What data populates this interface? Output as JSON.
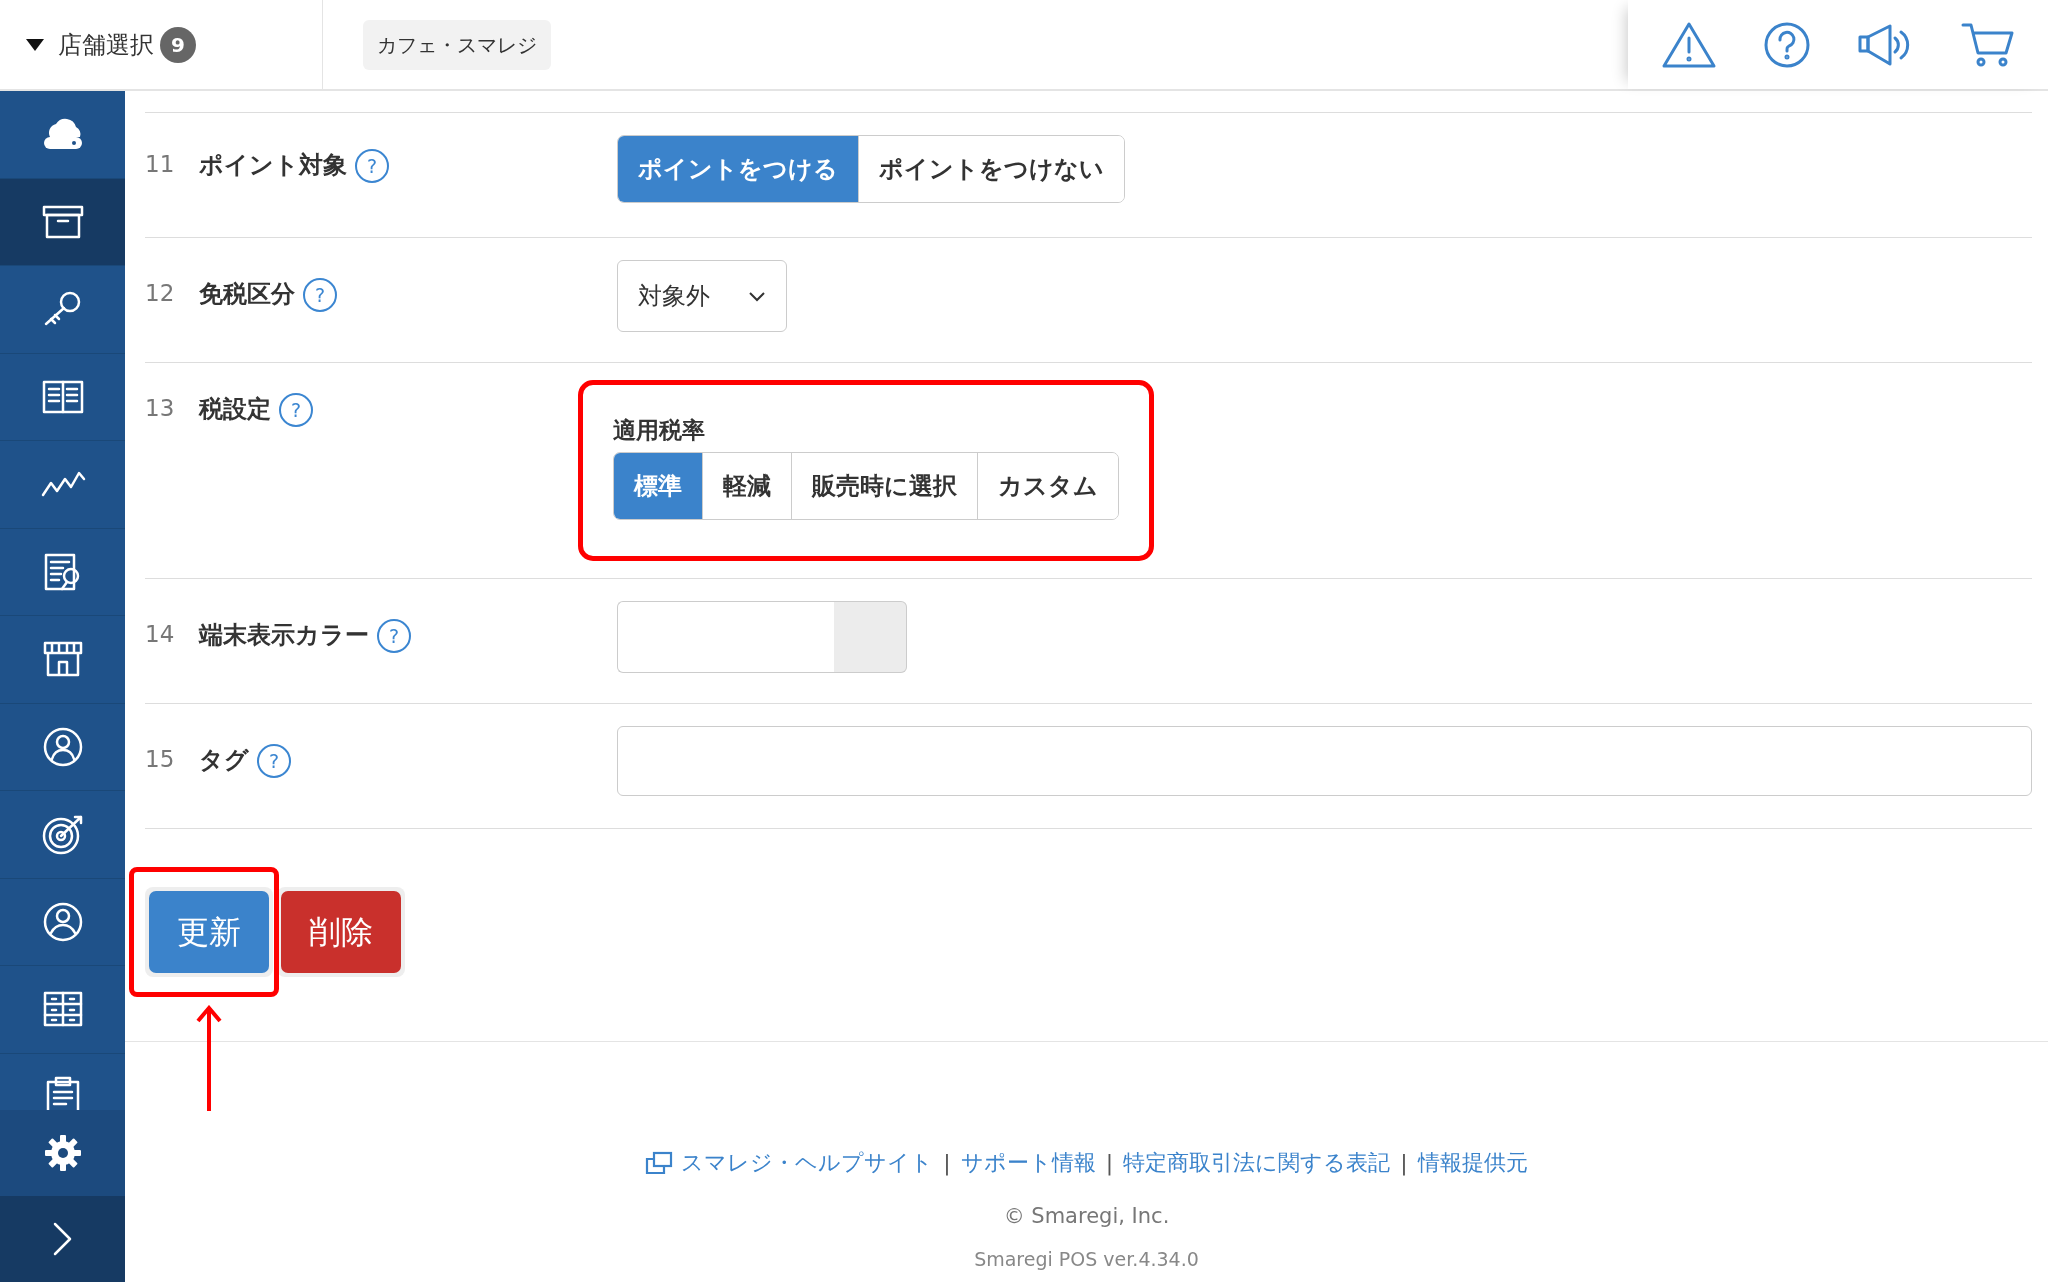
{
  "header": {
    "store_select": {
      "label": "店舗選択",
      "count": "9"
    },
    "store_name": "カフェ・スマレジ",
    "icons": [
      {
        "kind": "warning"
      },
      {
        "kind": "help"
      },
      {
        "kind": "megaphone"
      },
      {
        "kind": "cart"
      }
    ]
  },
  "sidebar": {
    "items": [
      {
        "kind": "cloud",
        "selected": false
      },
      {
        "kind": "box",
        "selected": true
      },
      {
        "kind": "key",
        "selected": false
      },
      {
        "kind": "book",
        "selected": false
      },
      {
        "kind": "chart",
        "selected": false
      },
      {
        "kind": "report",
        "selected": false
      },
      {
        "kind": "store",
        "selected": false
      },
      {
        "kind": "person-badge",
        "selected": false
      },
      {
        "kind": "target",
        "selected": false
      },
      {
        "kind": "person",
        "selected": false
      },
      {
        "kind": "drawers",
        "selected": false
      },
      {
        "kind": "clipboard",
        "selected": false
      }
    ],
    "bottom": [
      {
        "kind": "settings"
      },
      {
        "kind": "expand"
      }
    ]
  },
  "rows": [
    {
      "number": "11",
      "label": "ポイント対象",
      "help": "?",
      "kind": "toggle",
      "highlighted": false,
      "options": [
        {
          "label": "ポイントをつける",
          "selected": true
        },
        {
          "label": "ポイントをつけない",
          "selected": false
        }
      ]
    },
    {
      "number": "12",
      "label": "免税区分",
      "help": "?",
      "kind": "select",
      "value": "対象外"
    },
    {
      "number": "13",
      "label": "税設定",
      "help": "?",
      "kind": "toggle",
      "caption": "適用税率",
      "highlighted": true,
      "options": [
        {
          "label": "標準",
          "selected": true
        },
        {
          "label": "軽減",
          "selected": false
        },
        {
          "label": "販売時に選択",
          "selected": false
        },
        {
          "label": "カスタム",
          "selected": false
        }
      ]
    },
    {
      "number": "14",
      "label": "端末表示カラー",
      "help": "?",
      "kind": "color"
    },
    {
      "number": "15",
      "label": "タグ",
      "help": "?",
      "kind": "text"
    }
  ],
  "buttons": [
    {
      "label": "更新",
      "kind": "primary",
      "highlighted": true
    },
    {
      "label": "削除",
      "kind": "danger",
      "highlighted": false
    }
  ],
  "footer": {
    "links": [
      "スマレジ・ヘルプサイト",
      "サポート情報",
      "特定商取引法に関する表記",
      "情報提供元"
    ],
    "separator": "|",
    "copyright": "© Smaregi, Inc.",
    "version": "Smaregi POS ver.4.34.0"
  }
}
